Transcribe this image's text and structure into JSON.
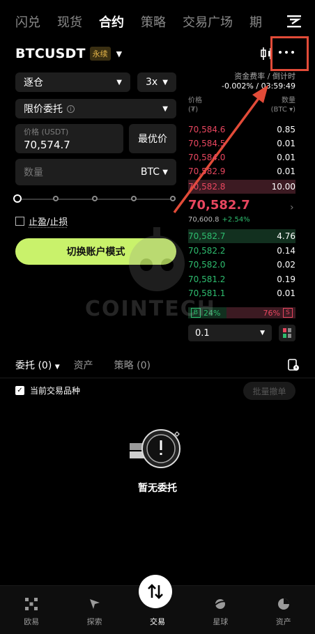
{
  "top_tabs": [
    "闪兑",
    "现货",
    "合约",
    "策略",
    "交易广场",
    "期"
  ],
  "active_tab_index": 2,
  "pair": {
    "symbol": "BTCUSDT",
    "badge": "永续"
  },
  "funding": {
    "label": "资金费率 / 倒计时",
    "rate": "-0.002%",
    "countdown": "03:59:49"
  },
  "form": {
    "margin_mode": "逐仓",
    "leverage": "3x",
    "order_type": "限价委托",
    "price_label": "价格 (USDT)",
    "price_value": "70,574.7",
    "best_price_label": "最优价",
    "qty_placeholder": "数量",
    "qty_unit": "BTC",
    "tpsl_label": "止盈/止损",
    "switch_label": "切换账户模式"
  },
  "order_book": {
    "price_header": "价格",
    "price_unit": "(₮)",
    "qty_header": "数量",
    "qty_unit": "(BTC ▾)",
    "asks": [
      {
        "price": "70,584.6",
        "qty": "0.85"
      },
      {
        "price": "70,584.5",
        "qty": "0.01"
      },
      {
        "price": "70,584.0",
        "qty": "0.01"
      },
      {
        "price": "70,582.9",
        "qty": "0.01"
      },
      {
        "price": "70,582.8",
        "qty": "10.00"
      }
    ],
    "last_price": "70,582.7",
    "mark_price": "70,600.8",
    "change": "+2.54%",
    "bids": [
      {
        "price": "70,582.7",
        "qty": "4.76"
      },
      {
        "price": "70,582.2",
        "qty": "0.14"
      },
      {
        "price": "70,582.0",
        "qty": "0.02"
      },
      {
        "price": "70,581.2",
        "qty": "0.19"
      },
      {
        "price": "70,581.1",
        "qty": "0.01"
      }
    ],
    "buy_tag": "B",
    "buy_ratio": "24%",
    "sell_ratio": "76%",
    "sell_tag": "S",
    "step": "0.1"
  },
  "orders": {
    "tabs": [
      "委托 (0)",
      "资产",
      "策略 (0)"
    ],
    "current_only_label": "当前交易品种",
    "batch_cancel_label": "批量撤单",
    "empty_label": "暂无委托"
  },
  "bottom_nav": [
    "欧易",
    "探索",
    "交易",
    "星球",
    "资产"
  ],
  "watermark": "COINTECH",
  "colors": {
    "accent": "#c9f26b",
    "ask": "#e8465f",
    "bid": "#2ebd6f",
    "highlight": "#e24b38"
  }
}
